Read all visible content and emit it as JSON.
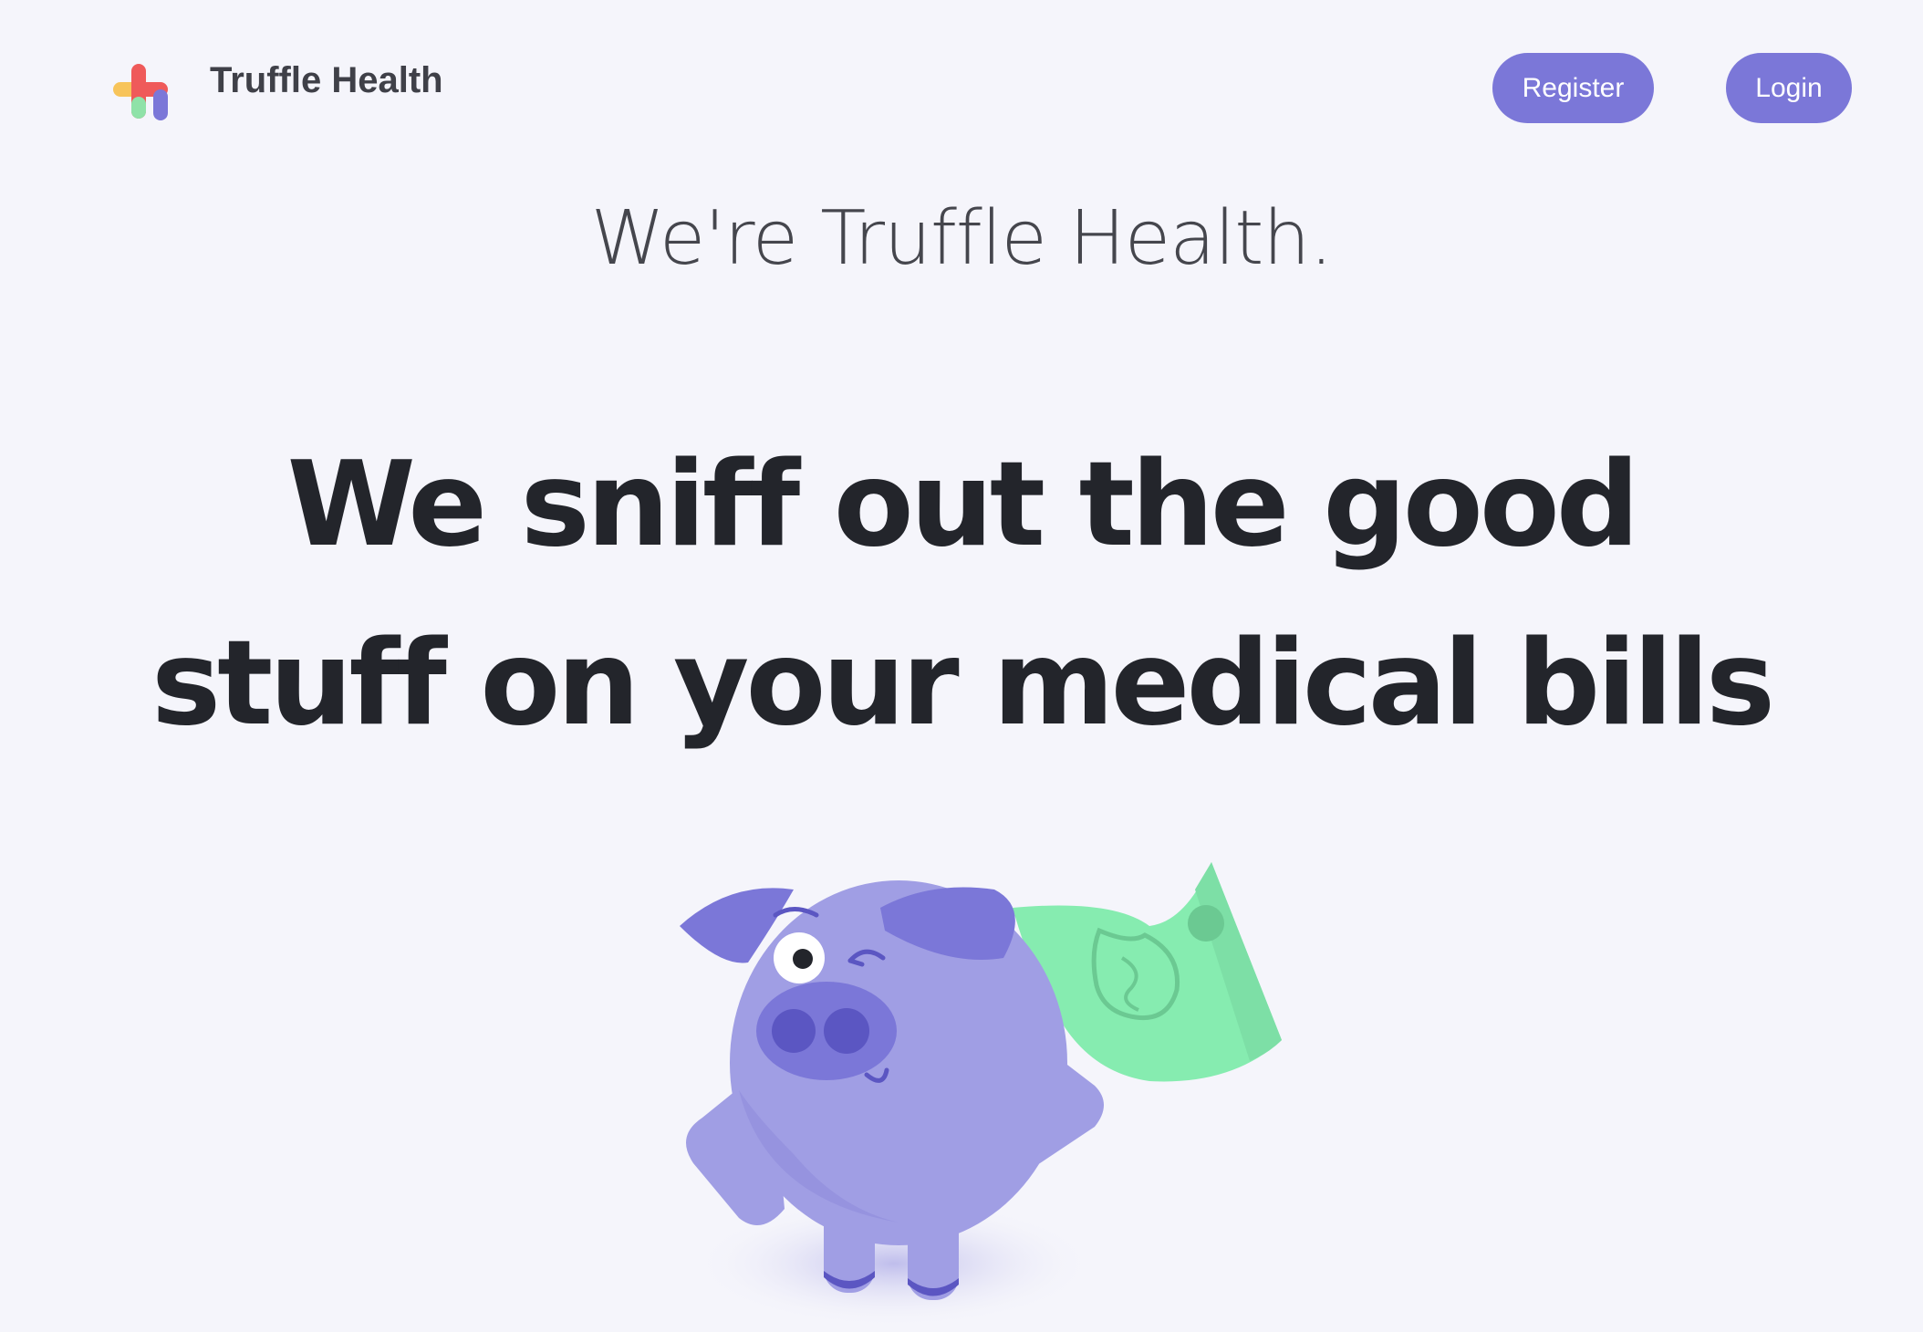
{
  "header": {
    "brand_name": "Truffle Health",
    "register_label": "Register",
    "login_label": "Login"
  },
  "hero": {
    "intro": "We're Truffle Health.",
    "headline_line1": "We sniff out the good",
    "headline_line2": "stuff on your medical bills"
  },
  "icons": {
    "logo": "truffle-health-plus-logo",
    "mascot": "pig-with-cash-cape-illustration"
  },
  "colors": {
    "background": "#f5f5fb",
    "button": "#7b77d8",
    "headline": "#23252b",
    "brand_text": "#3f4048",
    "pig": "#a09ee4",
    "cash": "#86ecb0"
  }
}
